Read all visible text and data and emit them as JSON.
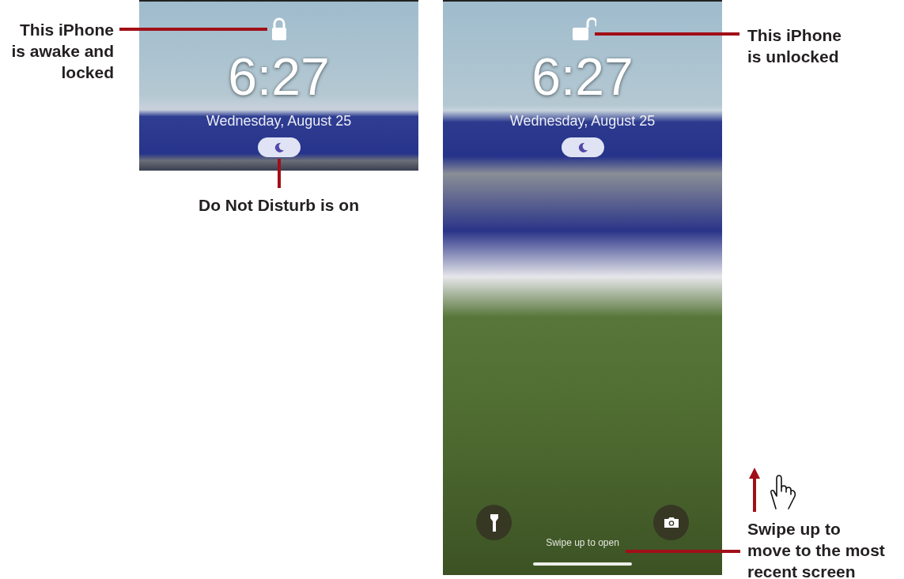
{
  "screens": [
    {
      "kind": "top",
      "locked": true,
      "time": "6:27",
      "date": "Wednesday, August 25",
      "do_not_disturb": true
    },
    {
      "kind": "full",
      "locked": false,
      "time": "6:27",
      "date": "Wednesday, August 25",
      "do_not_disturb": true,
      "swipe_hint": "Swipe up to open"
    }
  ],
  "callouts": [
    {
      "lines": [
        "This iPhone",
        "is awake and",
        "locked"
      ]
    },
    {
      "lines": [
        "Do Not Disturb is on"
      ]
    },
    {
      "lines": [
        "This iPhone",
        "is unlocked"
      ]
    },
    {
      "lines": [
        "Swipe up to",
        "move to the most",
        "recent screen"
      ]
    }
  ]
}
